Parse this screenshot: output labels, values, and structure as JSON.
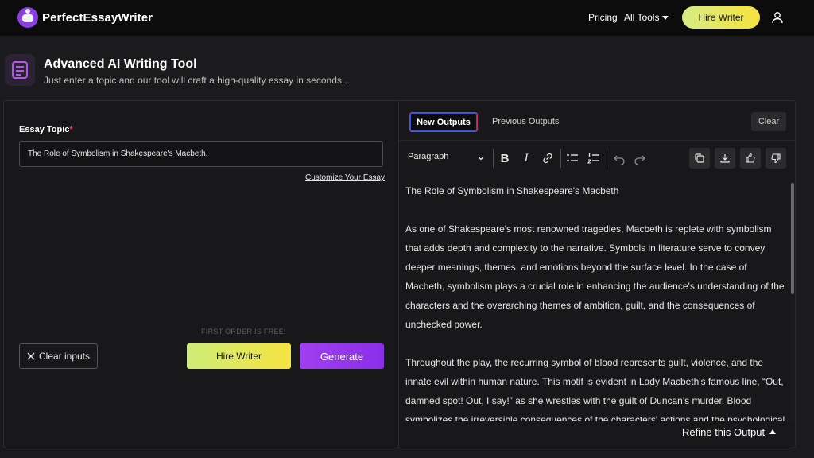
{
  "brand": {
    "name": "PerfectEssayWriter"
  },
  "nav": {
    "pricing": "Pricing",
    "all_tools": "All Tools",
    "hire_writer": "Hire Writer"
  },
  "hero": {
    "title": "Advanced AI Writing Tool",
    "subtitle": "Just enter a topic and our tool will craft a high-quality essay in seconds..."
  },
  "form": {
    "topic_label": "Essay Topic",
    "required_mark": "*",
    "topic_value": "The Role of Symbolism in Shakespeare's Macbeth.",
    "customize_link": "Customize Your Essay",
    "free_note": "FIRST ORDER IS FREE!",
    "clear_inputs": "Clear inputs",
    "hire_writer": "Hire Writer",
    "generate": "Generate"
  },
  "output": {
    "tabs": [
      {
        "label": "New Outputs",
        "active": true
      },
      {
        "label": "Previous Outputs",
        "active": false
      }
    ],
    "clear": "Clear",
    "format_select": "Paragraph",
    "paragraphs": [
      "The Role of Symbolism in Shakespeare's Macbeth",
      "As one of Shakespeare's most renowned tragedies, Macbeth is replete with symbolism that adds depth and complexity to the narrative. Symbols in literature serve to convey deeper meanings, themes, and emotions beyond the surface level. In the case of Macbeth, symbolism plays a crucial role in enhancing the audience's understanding of the characters and the overarching themes of ambition, guilt, and the consequences of unchecked power.",
      "Throughout the play, the recurring symbol of blood represents guilt, violence, and the innate evil within human nature. This motif is evident in Lady Macbeth's famous line, “Out, damned spot! Out, I say!” as she wrestles with the guilt of Duncan's murder. Blood symbolizes the irreversible consequences of the characters' actions and the psychological"
    ],
    "refine": "Refine this Output"
  },
  "colors": {
    "accent_purple": "#8a2ee8",
    "accent_yellow": "#f5e33e",
    "tab_border": "#c8306a"
  }
}
